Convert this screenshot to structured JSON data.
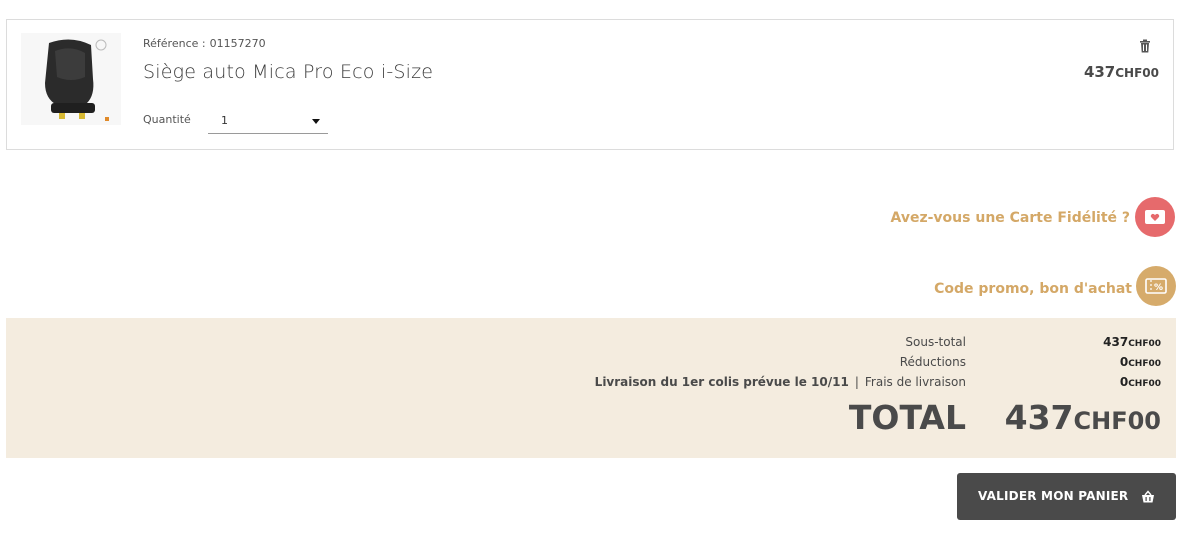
{
  "cart_item": {
    "reference_label": "Référence :",
    "reference_value": "01157270",
    "product_name": "Siège auto Mica Pro Eco i-Size",
    "quantity_label": "Quantité",
    "quantity_value": "1",
    "price_amount": "437",
    "price_currency": "CHF00"
  },
  "loyalty": {
    "label": "Avez-vous une Carte Fidélité ?"
  },
  "promo": {
    "label": "Code promo, bon d'achat"
  },
  "summary": {
    "subtotal_label": "Sous-total",
    "subtotal_amount": "437",
    "subtotal_currency": "CHF00",
    "discounts_label": "Réductions",
    "discounts_amount": "0",
    "discounts_currency": "CHF00",
    "delivery_note": "Livraison du 1er colis prévue le 10/11",
    "delivery_separator": "|",
    "shipping_label": "Frais de livraison",
    "shipping_amount": "0",
    "shipping_currency": "CHF00",
    "total_label": "TOTAL",
    "total_amount": "437",
    "total_currency": "CHF00"
  },
  "checkout": {
    "button_label": "VALIDER MON PANIER"
  },
  "colors": {
    "accent_gold": "#d4a867",
    "loyalty_red": "#e66a6c",
    "summary_bg": "#f4ecdf",
    "button_bg": "#4a4a4a"
  },
  "icons": [
    "trash-icon",
    "loyalty-card-icon",
    "promo-voucher-icon",
    "basket-icon",
    "dropdown-caret-icon"
  ]
}
